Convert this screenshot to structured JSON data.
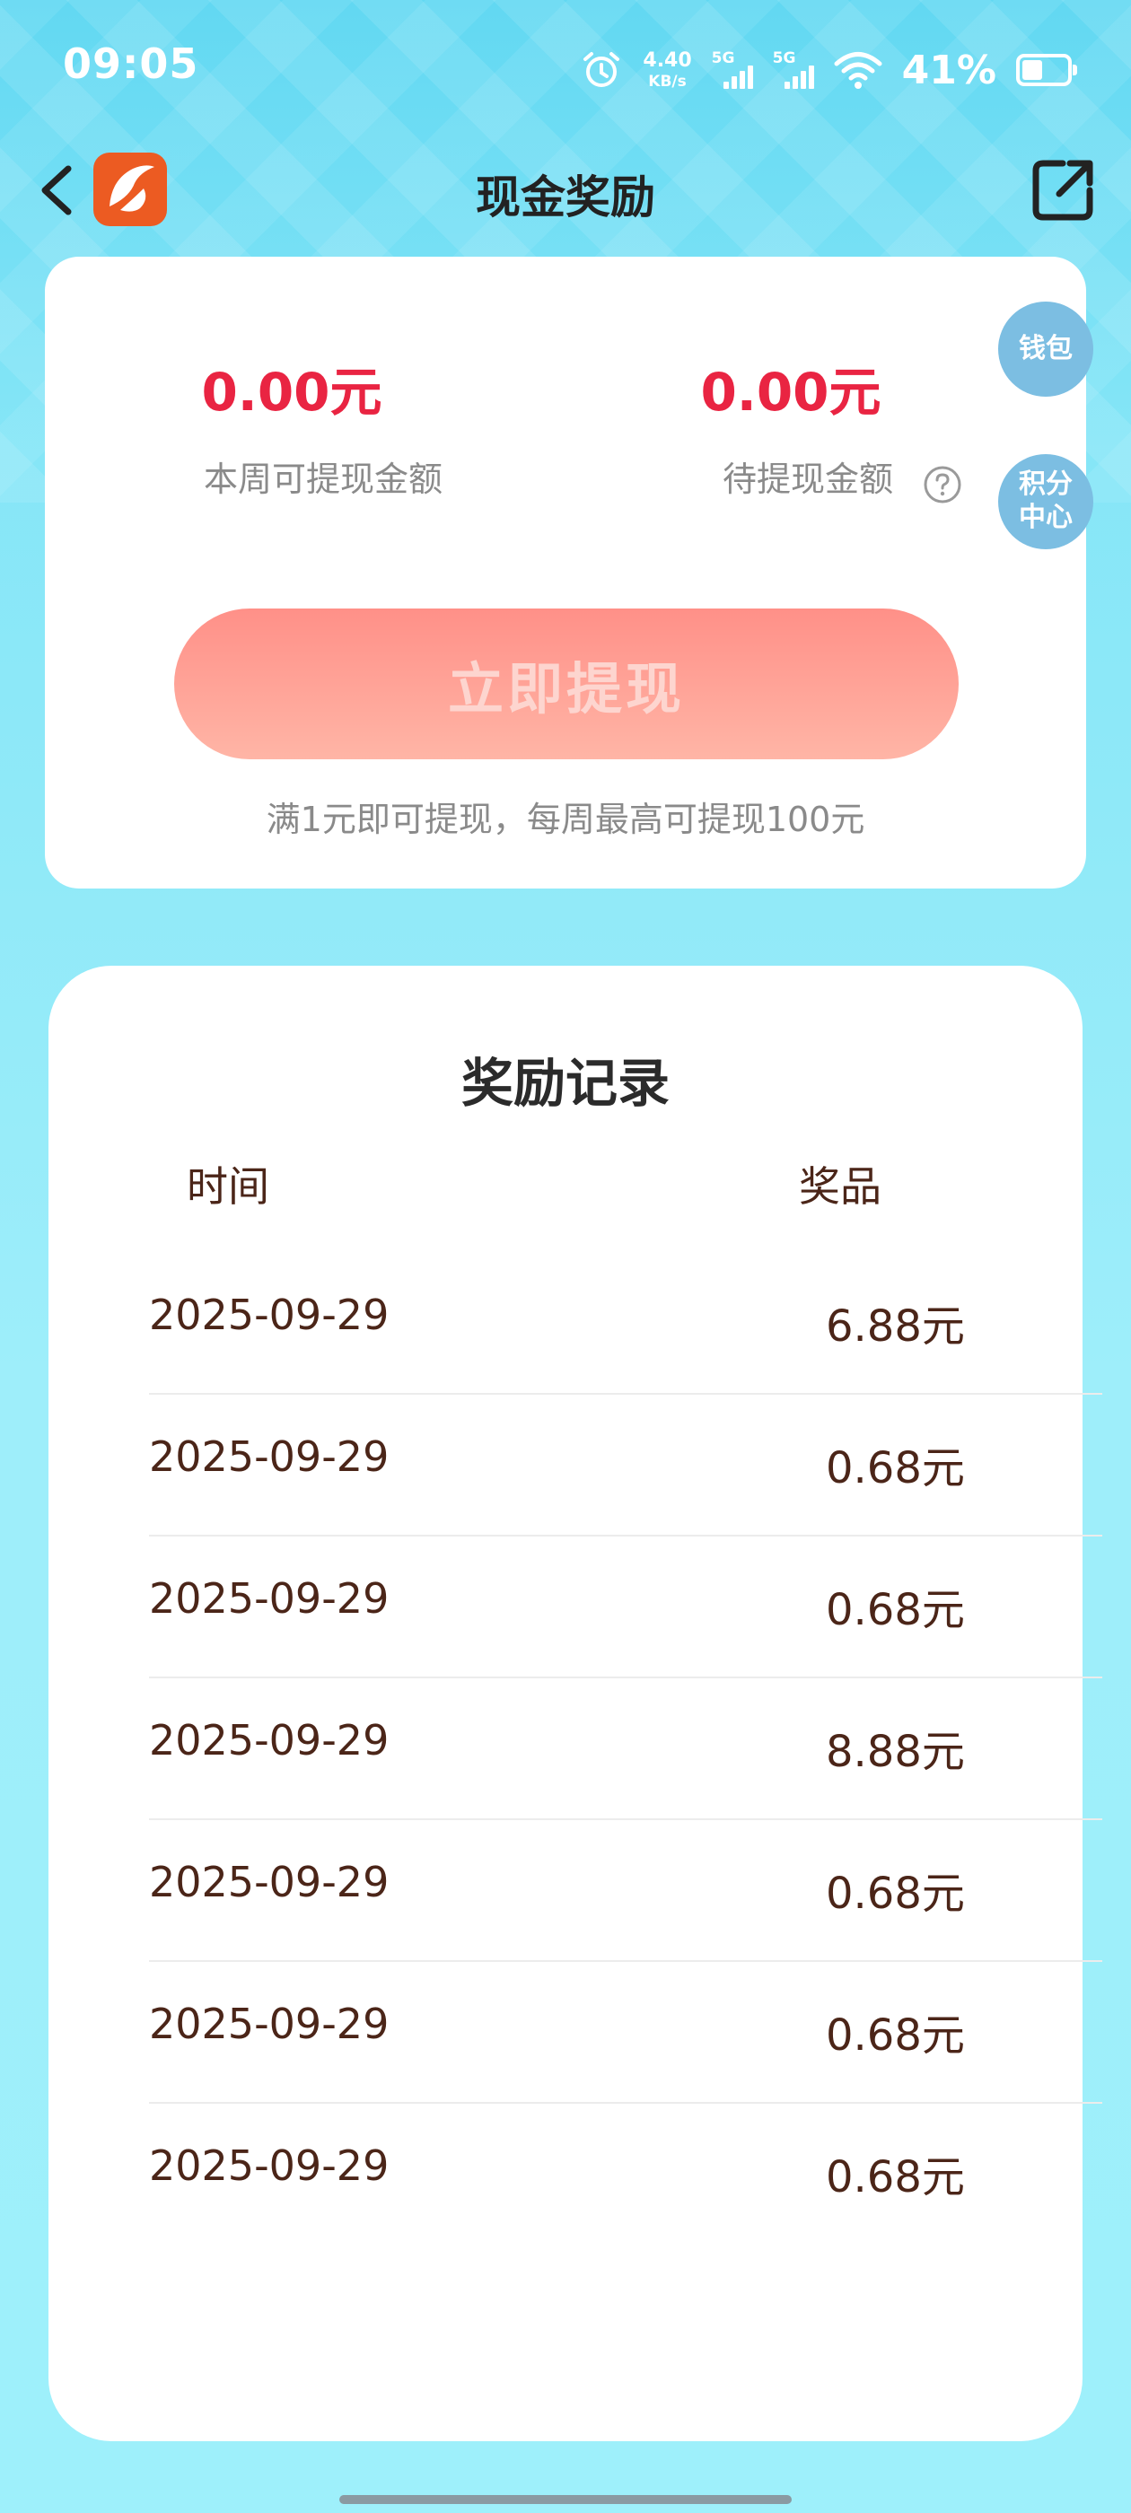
{
  "status_bar": {
    "time": "09:05",
    "net_speed": "4.40",
    "net_speed_unit": "KB/s",
    "sim1": "5G",
    "sim2": "5G",
    "battery": "41%",
    "icons": [
      "alarm-icon",
      "signal-icon",
      "wifi-icon",
      "battery-icon"
    ]
  },
  "header": {
    "title": "现金奖励",
    "back_icon": "chevron-left-icon",
    "logo_icon": "app-logo-icon",
    "share_icon": "share-icon"
  },
  "withdraw": {
    "weekly_amount": "0.00元",
    "weekly_label": "本周可提现金额",
    "pending_amount": "0.00元",
    "pending_label": "待提现金额",
    "help_icon": "question-circle-icon",
    "button_label": "立即提现",
    "note": "满1元即可提现，每周最高可提现100元"
  },
  "side_buttons": {
    "wallet": "钱包",
    "points": "积分中心"
  },
  "records": {
    "title": "奖励记录",
    "columns": [
      "时间",
      "奖品"
    ],
    "rows": [
      {
        "date": "2025-09-29",
        "prize": "6.88元"
      },
      {
        "date": "2025-09-29",
        "prize": "0.68元"
      },
      {
        "date": "2025-09-29",
        "prize": "0.68元"
      },
      {
        "date": "2025-09-29",
        "prize": "8.88元"
      },
      {
        "date": "2025-09-29",
        "prize": "0.68元"
      },
      {
        "date": "2025-09-29",
        "prize": "0.68元"
      },
      {
        "date": "2025-09-29",
        "prize": "0.68元"
      }
    ]
  },
  "colors": {
    "accent_red": "#e92442",
    "button_gradient_top": "#ff9088",
    "button_gradient_bottom": "#ffb5a6",
    "record_text": "#4b2518",
    "background": "#86e6f7"
  }
}
